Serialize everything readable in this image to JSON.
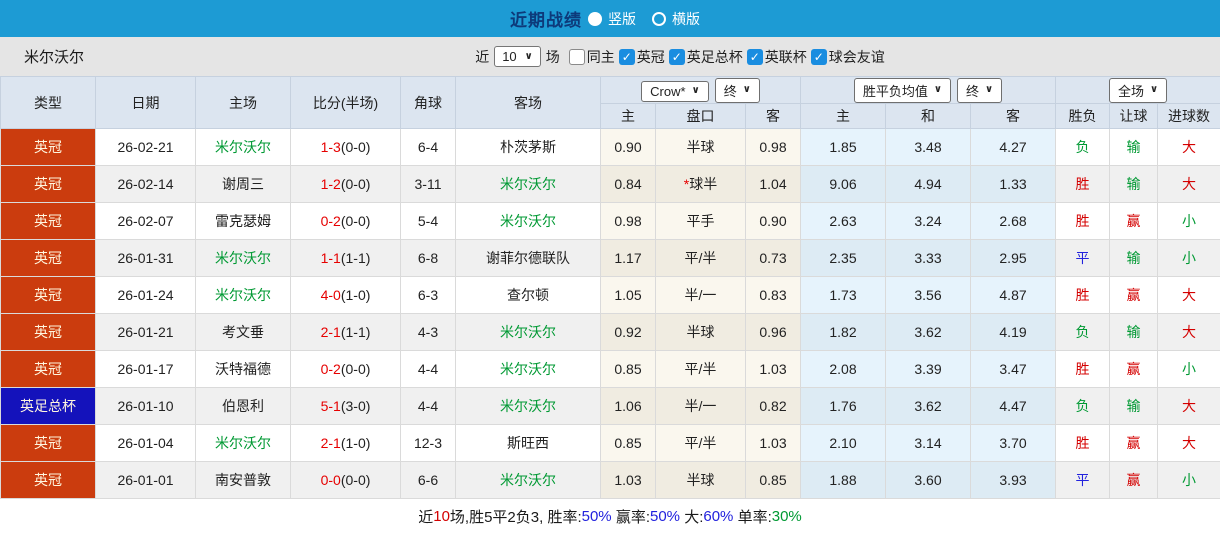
{
  "topbar": {
    "title": "近期战绩",
    "layout_options": [
      {
        "label": "竖版",
        "selected": true
      },
      {
        "label": "横版",
        "selected": false
      }
    ]
  },
  "filter": {
    "team": "米尔沃尔",
    "recent_prefix": "近",
    "recent_count": "10",
    "recent_suffix": "场",
    "checkboxes": [
      {
        "label": "同主",
        "checked": false
      },
      {
        "label": "英冠",
        "checked": true
      },
      {
        "label": "英足总杯",
        "checked": true
      },
      {
        "label": "英联杯",
        "checked": true
      },
      {
        "label": "球会友谊",
        "checked": true
      }
    ],
    "check_glyph": "✓"
  },
  "table": {
    "headers": [
      "类型",
      "日期",
      "主场",
      "比分(半场)",
      "角球",
      "客场"
    ],
    "sub_headers": [
      "主",
      "盘口",
      "客",
      "主",
      "和",
      "客",
      "胜负",
      "让球",
      "进球数"
    ],
    "dropdowns": {
      "crow": "Crow*",
      "final1": "终",
      "avg": "胜平负均值",
      "final2": "终",
      "period": "全场"
    },
    "league_colors": {
      "red": "#cb3c0e",
      "blue": "#1412bb"
    },
    "rows": [
      {
        "league": "英冠",
        "league_color": "red",
        "date": "26-02-21",
        "home": "米尔沃尔",
        "home_focus": true,
        "score": "1-3",
        "half": "(0-0)",
        "corners": "6-4",
        "away": "朴茨茅斯",
        "away_focus": false,
        "odds_home": "0.90",
        "handicap_star": false,
        "handicap": "半球",
        "odds_away": "0.98",
        "avg_win": "1.85",
        "avg_draw": "3.48",
        "avg_lose": "4.27",
        "result": {
          "text": "负",
          "c": "green"
        },
        "handicap_result": {
          "text": "输",
          "c": "green"
        },
        "goals_result": {
          "text": "大",
          "c": "red"
        }
      },
      {
        "league": "英冠",
        "league_color": "red",
        "date": "26-02-14",
        "home": "谢周三",
        "home_focus": false,
        "score": "1-2",
        "half": "(0-0)",
        "corners": "3-11",
        "away": "米尔沃尔",
        "away_focus": true,
        "odds_home": "0.84",
        "handicap_star": true,
        "handicap": "球半",
        "odds_away": "1.04",
        "avg_win": "9.06",
        "avg_draw": "4.94",
        "avg_lose": "1.33",
        "result": {
          "text": "胜",
          "c": "red"
        },
        "handicap_result": {
          "text": "输",
          "c": "green"
        },
        "goals_result": {
          "text": "大",
          "c": "red"
        }
      },
      {
        "league": "英冠",
        "league_color": "red",
        "date": "26-02-07",
        "home": "雷克瑟姆",
        "home_focus": false,
        "score": "0-2",
        "half": "(0-0)",
        "corners": "5-4",
        "away": "米尔沃尔",
        "away_focus": true,
        "odds_home": "0.98",
        "handicap_star": false,
        "handicap": "平手",
        "odds_away": "0.90",
        "avg_win": "2.63",
        "avg_draw": "3.24",
        "avg_lose": "2.68",
        "result": {
          "text": "胜",
          "c": "red"
        },
        "handicap_result": {
          "text": "赢",
          "c": "red"
        },
        "goals_result": {
          "text": "小",
          "c": "green"
        }
      },
      {
        "league": "英冠",
        "league_color": "red",
        "date": "26-01-31",
        "home": "米尔沃尔",
        "home_focus": true,
        "score": "1-1",
        "half": "(1-1)",
        "corners": "6-8",
        "away": "谢菲尔德联队",
        "away_focus": false,
        "odds_home": "1.17",
        "handicap_star": false,
        "handicap": "平/半",
        "odds_away": "0.73",
        "avg_win": "2.35",
        "avg_draw": "3.33",
        "avg_lose": "2.95",
        "result": {
          "text": "平",
          "c": "blue"
        },
        "handicap_result": {
          "text": "输",
          "c": "green"
        },
        "goals_result": {
          "text": "小",
          "c": "green"
        }
      },
      {
        "league": "英冠",
        "league_color": "red",
        "date": "26-01-24",
        "home": "米尔沃尔",
        "home_focus": true,
        "score": "4-0",
        "half": "(1-0)",
        "corners": "6-3",
        "away": "查尔顿",
        "away_focus": false,
        "odds_home": "1.05",
        "handicap_star": false,
        "handicap": "半/一",
        "odds_away": "0.83",
        "avg_win": "1.73",
        "avg_draw": "3.56",
        "avg_lose": "4.87",
        "result": {
          "text": "胜",
          "c": "red"
        },
        "handicap_result": {
          "text": "赢",
          "c": "red"
        },
        "goals_result": {
          "text": "大",
          "c": "red"
        }
      },
      {
        "league": "英冠",
        "league_color": "red",
        "date": "26-01-21",
        "home": "考文垂",
        "home_focus": false,
        "score": "2-1",
        "half": "(1-1)",
        "corners": "4-3",
        "away": "米尔沃尔",
        "away_focus": true,
        "odds_home": "0.92",
        "handicap_star": false,
        "handicap": "半球",
        "odds_away": "0.96",
        "avg_win": "1.82",
        "avg_draw": "3.62",
        "avg_lose": "4.19",
        "result": {
          "text": "负",
          "c": "green"
        },
        "handicap_result": {
          "text": "输",
          "c": "green"
        },
        "goals_result": {
          "text": "大",
          "c": "red"
        }
      },
      {
        "league": "英冠",
        "league_color": "red",
        "date": "26-01-17",
        "home": "沃特福德",
        "home_focus": false,
        "score": "0-2",
        "half": "(0-0)",
        "corners": "4-4",
        "away": "米尔沃尔",
        "away_focus": true,
        "odds_home": "0.85",
        "handicap_star": false,
        "handicap": "平/半",
        "odds_away": "1.03",
        "avg_win": "2.08",
        "avg_draw": "3.39",
        "avg_lose": "3.47",
        "result": {
          "text": "胜",
          "c": "red"
        },
        "handicap_result": {
          "text": "赢",
          "c": "red"
        },
        "goals_result": {
          "text": "小",
          "c": "green"
        }
      },
      {
        "league": "英足总杯",
        "league_color": "blue",
        "date": "26-01-10",
        "home": "伯恩利",
        "home_focus": false,
        "score": "5-1",
        "half": "(3-0)",
        "corners": "4-4",
        "away": "米尔沃尔",
        "away_focus": true,
        "odds_home": "1.06",
        "handicap_star": false,
        "handicap": "半/一",
        "odds_away": "0.82",
        "avg_win": "1.76",
        "avg_draw": "3.62",
        "avg_lose": "4.47",
        "result": {
          "text": "负",
          "c": "green"
        },
        "handicap_result": {
          "text": "输",
          "c": "green"
        },
        "goals_result": {
          "text": "大",
          "c": "red"
        }
      },
      {
        "league": "英冠",
        "league_color": "red",
        "date": "26-01-04",
        "home": "米尔沃尔",
        "home_focus": true,
        "score": "2-1",
        "half": "(1-0)",
        "corners": "12-3",
        "away": "斯旺西",
        "away_focus": false,
        "odds_home": "0.85",
        "handicap_star": false,
        "handicap": "平/半",
        "odds_away": "1.03",
        "avg_win": "2.10",
        "avg_draw": "3.14",
        "avg_lose": "3.70",
        "result": {
          "text": "胜",
          "c": "red"
        },
        "handicap_result": {
          "text": "赢",
          "c": "red"
        },
        "goals_result": {
          "text": "大",
          "c": "red"
        }
      },
      {
        "league": "英冠",
        "league_color": "red",
        "date": "26-01-01",
        "home": "南安普敦",
        "home_focus": false,
        "score": "0-0",
        "half": "(0-0)",
        "corners": "6-6",
        "away": "米尔沃尔",
        "away_focus": true,
        "odds_home": "1.03",
        "handicap_star": false,
        "handicap": "半球",
        "odds_away": "0.85",
        "avg_win": "1.88",
        "avg_draw": "3.60",
        "avg_lose": "3.93",
        "result": {
          "text": "平",
          "c": "blue"
        },
        "handicap_result": {
          "text": "赢",
          "c": "red"
        },
        "goals_result": {
          "text": "小",
          "c": "green"
        }
      }
    ]
  },
  "footer": {
    "segments": [
      {
        "text": "近",
        "c": "k"
      },
      {
        "text": "10",
        "c": "red"
      },
      {
        "text": "场,胜5平2负3, 胜率:",
        "c": "k"
      },
      {
        "text": "50%",
        "c": "blue"
      },
      {
        "text": " 赢率:",
        "c": "k"
      },
      {
        "text": "50%",
        "c": "blue"
      },
      {
        "text": " 大:",
        "c": "k"
      },
      {
        "text": "60%",
        "c": "blue"
      },
      {
        "text": " 单率:",
        "c": "k"
      },
      {
        "text": "30%",
        "c": "green"
      }
    ]
  }
}
